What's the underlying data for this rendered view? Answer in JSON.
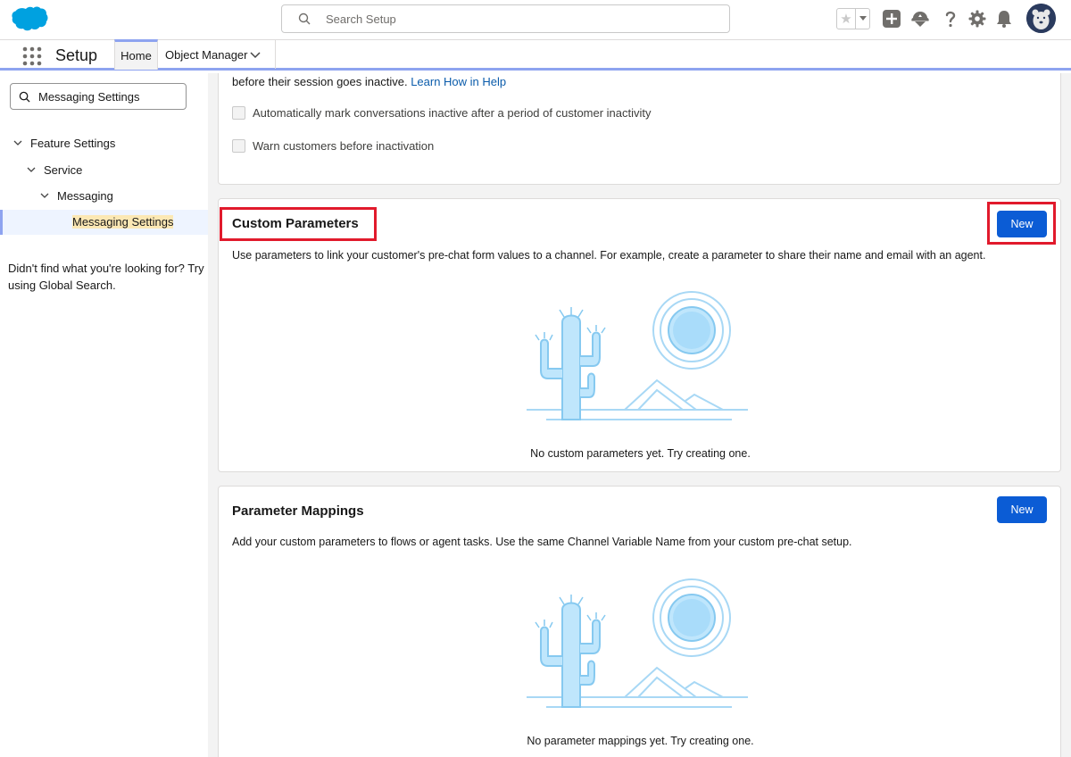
{
  "header": {
    "search_placeholder": "Search Setup",
    "brand_color": "#00a1e0"
  },
  "nav": {
    "app_name": "Setup",
    "tabs": [
      {
        "label": "Home",
        "active": true
      },
      {
        "label": "Object Manager",
        "active": false
      }
    ]
  },
  "sidebar": {
    "quick_find_value": "Messaging Settings",
    "tree": [
      {
        "label": "Feature Settings",
        "level": 0,
        "expanded": true
      },
      {
        "label": "Service",
        "level": 1,
        "expanded": true
      },
      {
        "label": "Messaging",
        "level": 2,
        "expanded": true
      },
      {
        "label": "Messaging Settings",
        "level": 3,
        "selected": true
      }
    ],
    "help_text": "Didn't find what you're looking for? Try using Global Search."
  },
  "main": {
    "inactivity_card": {
      "line1_text": "before their session goes inactive.",
      "line1_link": "Learn How in Help",
      "checkbox1_label": "Automatically mark conversations inactive after a period of customer inactivity",
      "checkbox2_label": "Warn customers before inactivation"
    },
    "custom_parameters": {
      "title": "Custom Parameters",
      "new_button": "New",
      "description": "Use parameters to link your customer's pre-chat form values to a channel. For example, create a parameter to share their name and email with an agent.",
      "empty_text": "No custom parameters yet. Try creating one."
    },
    "parameter_mappings": {
      "title": "Parameter Mappings",
      "new_button": "New",
      "description": "Add your custom parameters to flows or agent tasks. Use the same Channel Variable Name from your custom pre-chat setup.",
      "empty_text": "No parameter mappings yet. Try creating one."
    },
    "highlight_color": "#e11a2c"
  }
}
